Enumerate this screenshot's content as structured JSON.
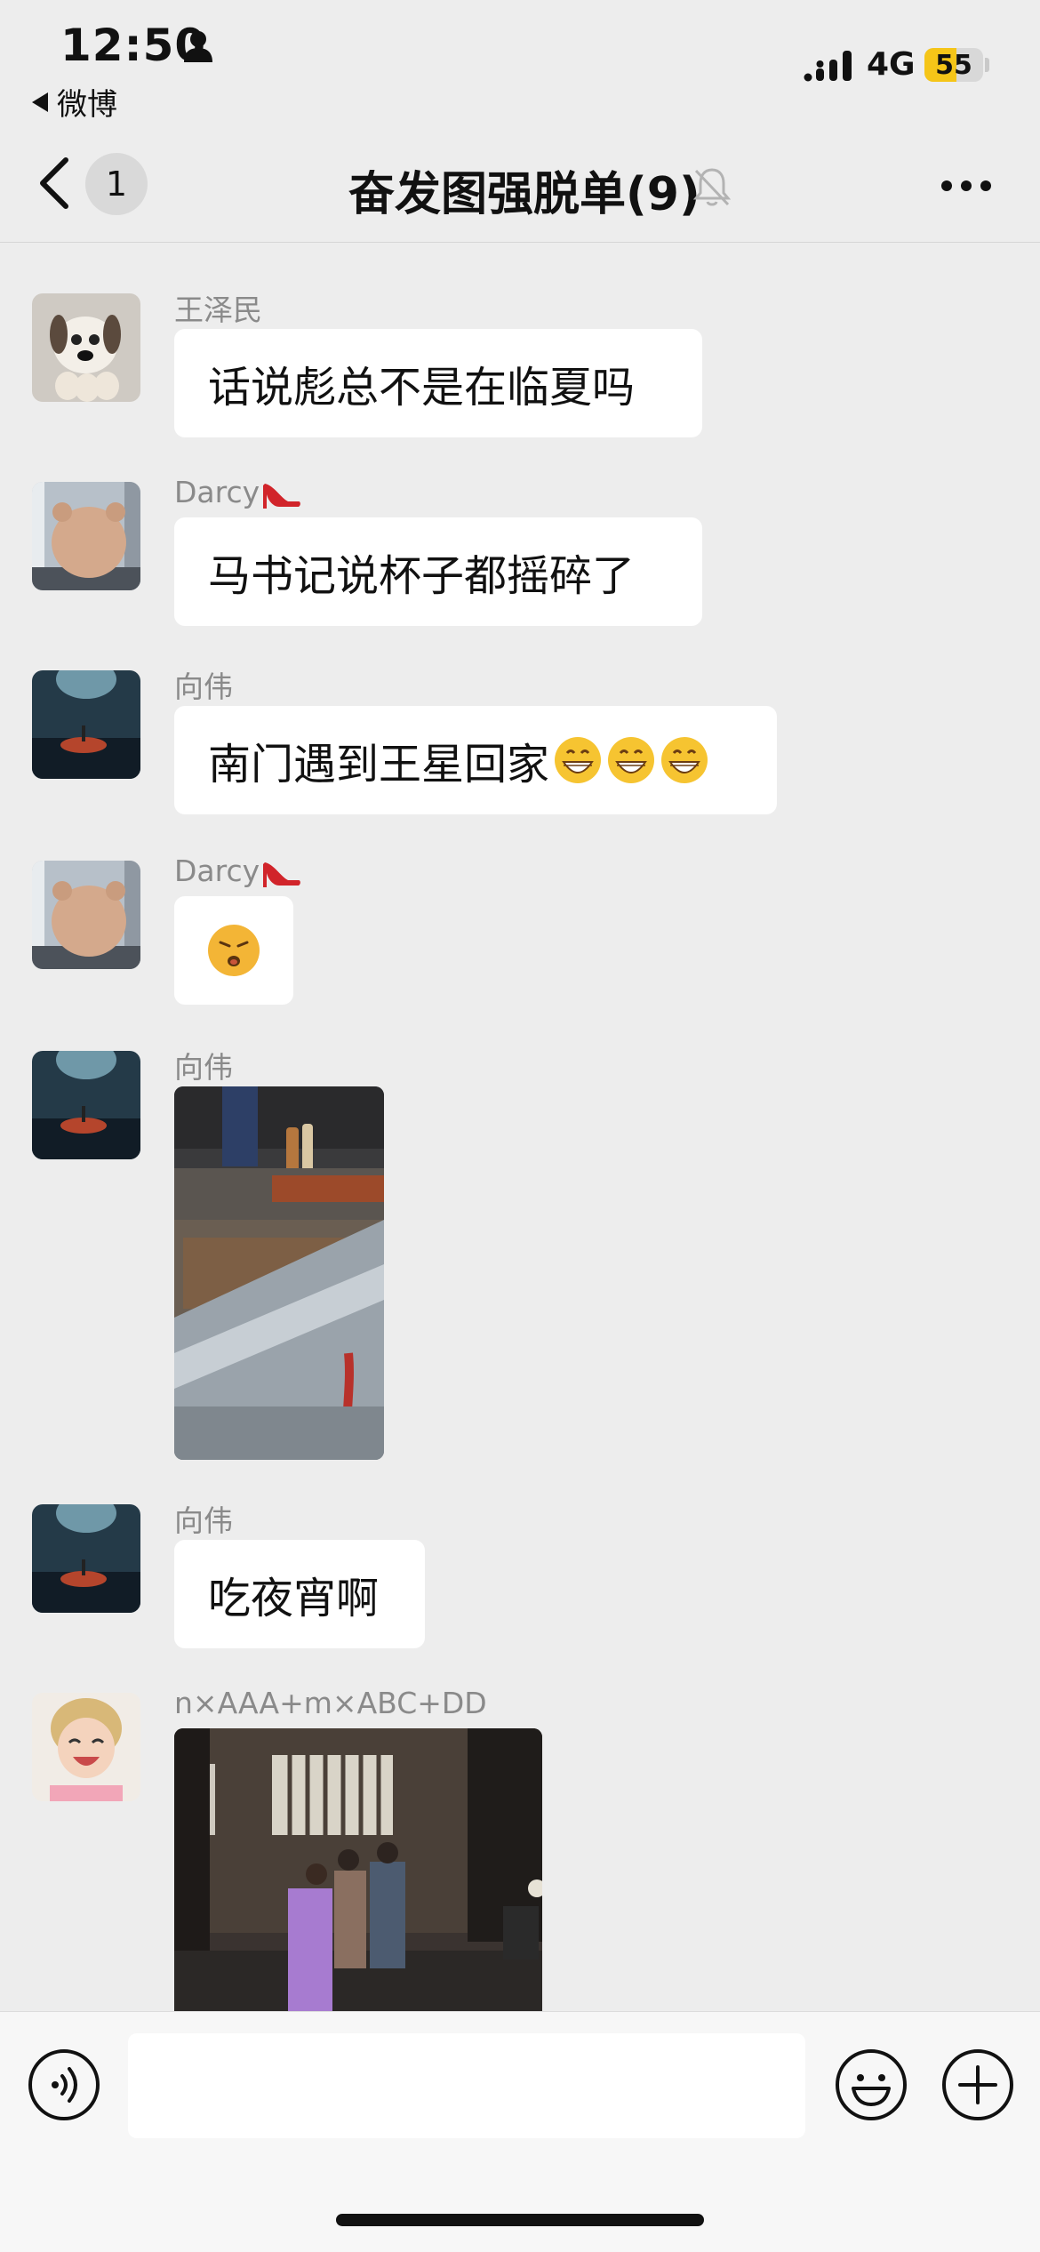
{
  "status_bar": {
    "time": "12:50",
    "back_app_label": "微博",
    "network": "4G",
    "battery_level": "55",
    "battery_fraction": 0.55
  },
  "nav": {
    "unread_count": "1",
    "title": "奋发图强脱单(9)"
  },
  "messages": [
    {
      "sender": "王泽民",
      "type": "text",
      "text": "话说彪总不是在临夏吗"
    },
    {
      "sender": "Darcy",
      "sender_emoji": "high-heel",
      "type": "text",
      "text": "马书记说杯子都摇碎了"
    },
    {
      "sender": "向伟",
      "type": "text",
      "text": "南门遇到王星回家",
      "trailing_emoji": "grinning-face x3"
    },
    {
      "sender": "Darcy",
      "sender_emoji": "high-heel",
      "type": "sticker",
      "sticker": "pouting-face"
    },
    {
      "sender": "向伟",
      "type": "image",
      "image": "food-stall-photo"
    },
    {
      "sender": "向伟",
      "type": "text",
      "text": "吃夜宵啊"
    },
    {
      "sender": "n×AAA+m×ABC+DD",
      "type": "image",
      "image": "night-street-photo"
    }
  ],
  "input_bar": {
    "placeholder": "",
    "icons": [
      "voice-icon",
      "emoji-icon",
      "plus-icon"
    ]
  }
}
